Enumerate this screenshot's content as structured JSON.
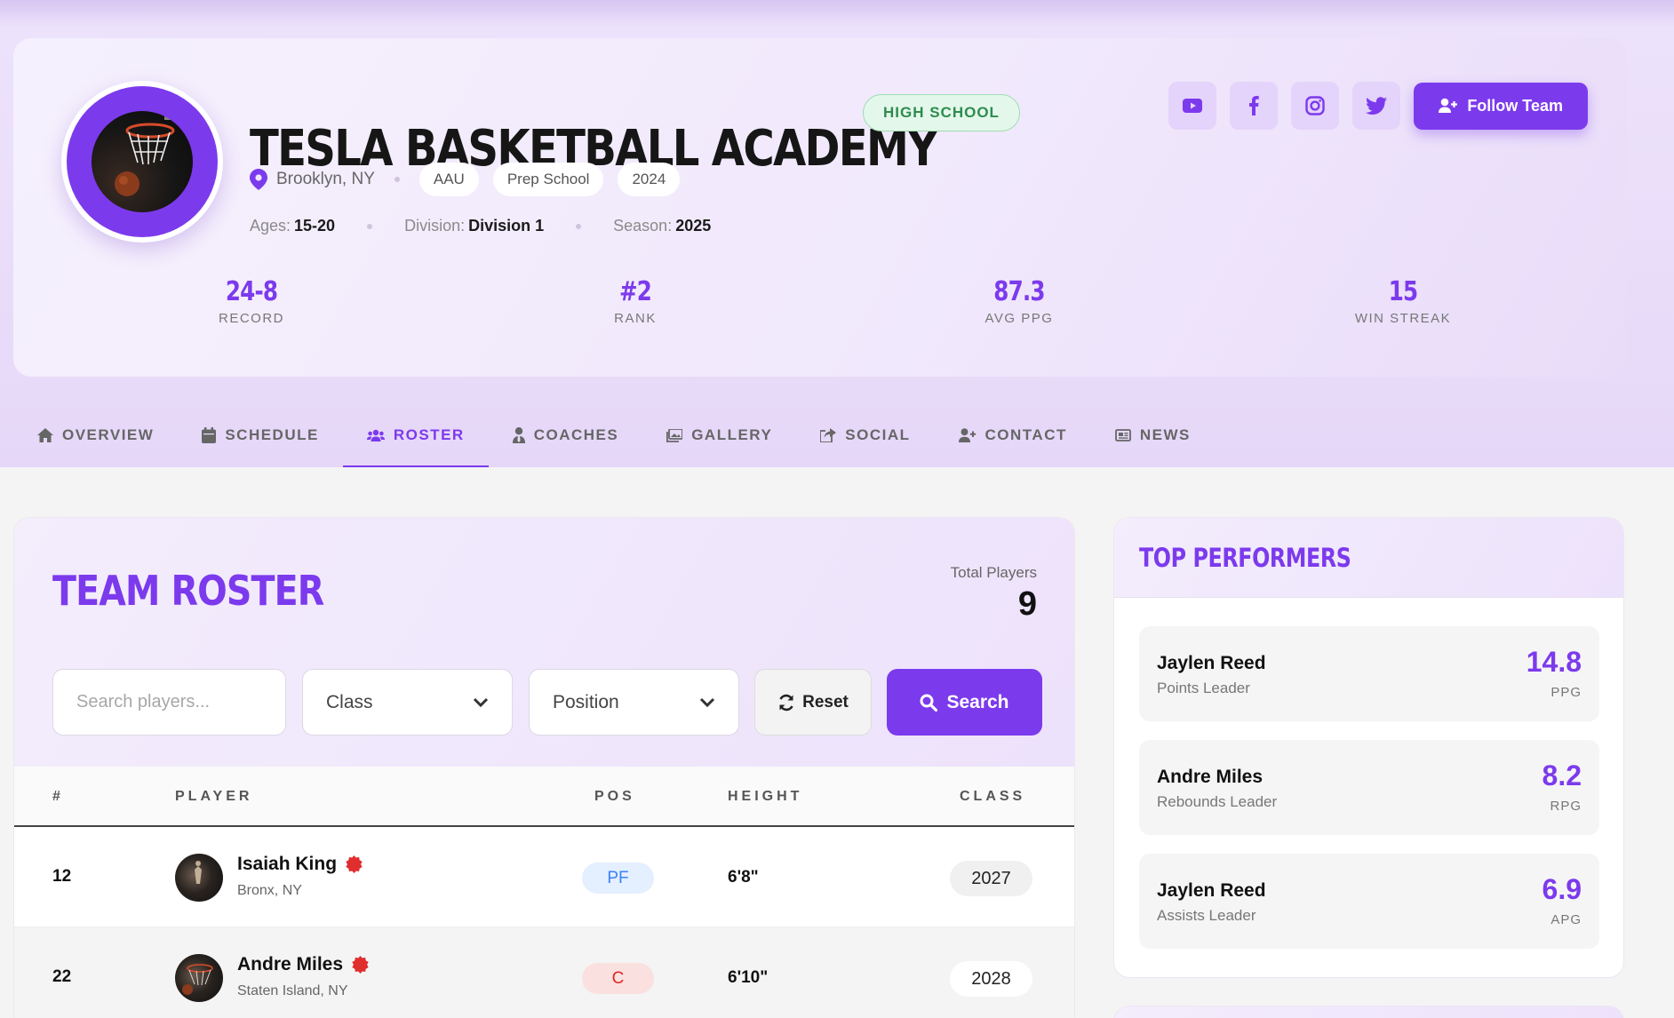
{
  "team": {
    "name": "TESLA BASKETBALL ACADEMY",
    "level_badge": "HIGH SCHOOL",
    "location": "Brooklyn, NY",
    "tags": [
      "AAU",
      "Prep School",
      "2024"
    ],
    "ages_label": "Ages:",
    "ages": "15-20",
    "division_label": "Division:",
    "division": "Division 1",
    "season_label": "Season:",
    "season": "2025"
  },
  "actions": {
    "social_icons": [
      "youtube-icon",
      "facebook-icon",
      "instagram-icon",
      "twitter-icon"
    ],
    "follow_label": "Follow Team"
  },
  "stats": [
    {
      "value": "24-8",
      "label": "RECORD"
    },
    {
      "value": "#2",
      "label": "RANK"
    },
    {
      "value": "87.3",
      "label": "AVG PPG"
    },
    {
      "value": "15",
      "label": "WIN STREAK"
    }
  ],
  "tabs": [
    {
      "label": "OVERVIEW",
      "icon": "home-icon"
    },
    {
      "label": "SCHEDULE",
      "icon": "calendar-icon"
    },
    {
      "label": "ROSTER",
      "icon": "users-icon",
      "active": true
    },
    {
      "label": "COACHES",
      "icon": "user-tie-icon"
    },
    {
      "label": "GALLERY",
      "icon": "images-icon"
    },
    {
      "label": "SOCIAL",
      "icon": "share-icon"
    },
    {
      "label": "CONTACT",
      "icon": "user-plus-icon"
    },
    {
      "label": "NEWS",
      "icon": "newspaper-icon"
    }
  ],
  "roster": {
    "title": "TEAM ROSTER",
    "total_label": "Total Players",
    "total": "9",
    "search_placeholder": "Search players...",
    "class_select": "Class",
    "position_select": "Position",
    "reset_label": "Reset",
    "search_label": "Search",
    "columns": [
      "#",
      "PLAYER",
      "POS",
      "HEIGHT",
      "CLASS"
    ],
    "rows": [
      {
        "number": "12",
        "name": "Isaiah King",
        "hometown": "Bronx, NY",
        "pos": "PF",
        "height": "6'8\"",
        "class": "2027"
      },
      {
        "number": "22",
        "name": "Andre Miles",
        "hometown": "Staten Island, NY",
        "pos": "C",
        "height": "6'10\"",
        "class": "2028"
      }
    ]
  },
  "performers": {
    "title": "TOP PERFORMERS",
    "items": [
      {
        "name": "Jaylen Reed",
        "role": "Points Leader",
        "value": "14.8",
        "unit": "PPG"
      },
      {
        "name": "Andre Miles",
        "role": "Rebounds Leader",
        "value": "8.2",
        "unit": "RPG"
      },
      {
        "name": "Jaylen Reed",
        "role": "Assists Leader",
        "value": "6.9",
        "unit": "APG"
      }
    ]
  },
  "colors": {
    "accent": "#7c3aed",
    "badge_green": "#2e8b4f",
    "pos_pf": "#3b82f6",
    "pos_c": "#dc2626"
  }
}
